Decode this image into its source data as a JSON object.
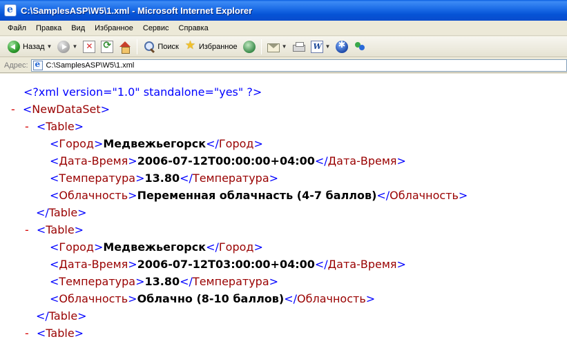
{
  "window": {
    "title": "C:\\SamplesASP\\W5\\1.xml - Microsoft Internet Explorer"
  },
  "menu": [
    "Файл",
    "Правка",
    "Вид",
    "Избранное",
    "Сервис",
    "Справка"
  ],
  "toolbar": {
    "back_label": "Назад",
    "search_label": "Поиск",
    "favorites_label": "Избранное"
  },
  "address": {
    "label": "Адрес:",
    "value": "C:\\SamplesASP\\W5\\1.xml"
  },
  "xml": {
    "declaration": "<?xml version=\"1.0\" standalone=\"yes\" ?>",
    "collapse_marker": "-",
    "root_tag": "NewDataSet",
    "table_tag": "Table",
    "fields": {
      "city": "Город",
      "datetime": "Дата-Время",
      "temperature": "Температура",
      "cloudiness": "Облачность"
    },
    "records": [
      {
        "city": "Медвежьегорск",
        "datetime": "2006-07-12T00:00:00+04:00",
        "temperature": "13.80",
        "cloudiness": "Переменная облачнасть (4-7 баллов)"
      },
      {
        "city": "Медвежьегорск",
        "datetime": "2006-07-12T03:00:00+04:00",
        "temperature": "13.80",
        "cloudiness": "Облачно (8-10 баллов)"
      }
    ]
  },
  "colors": {
    "markup_blue": "#0000ff",
    "tag_name": "#990000",
    "collapse_red": "#d60000"
  }
}
